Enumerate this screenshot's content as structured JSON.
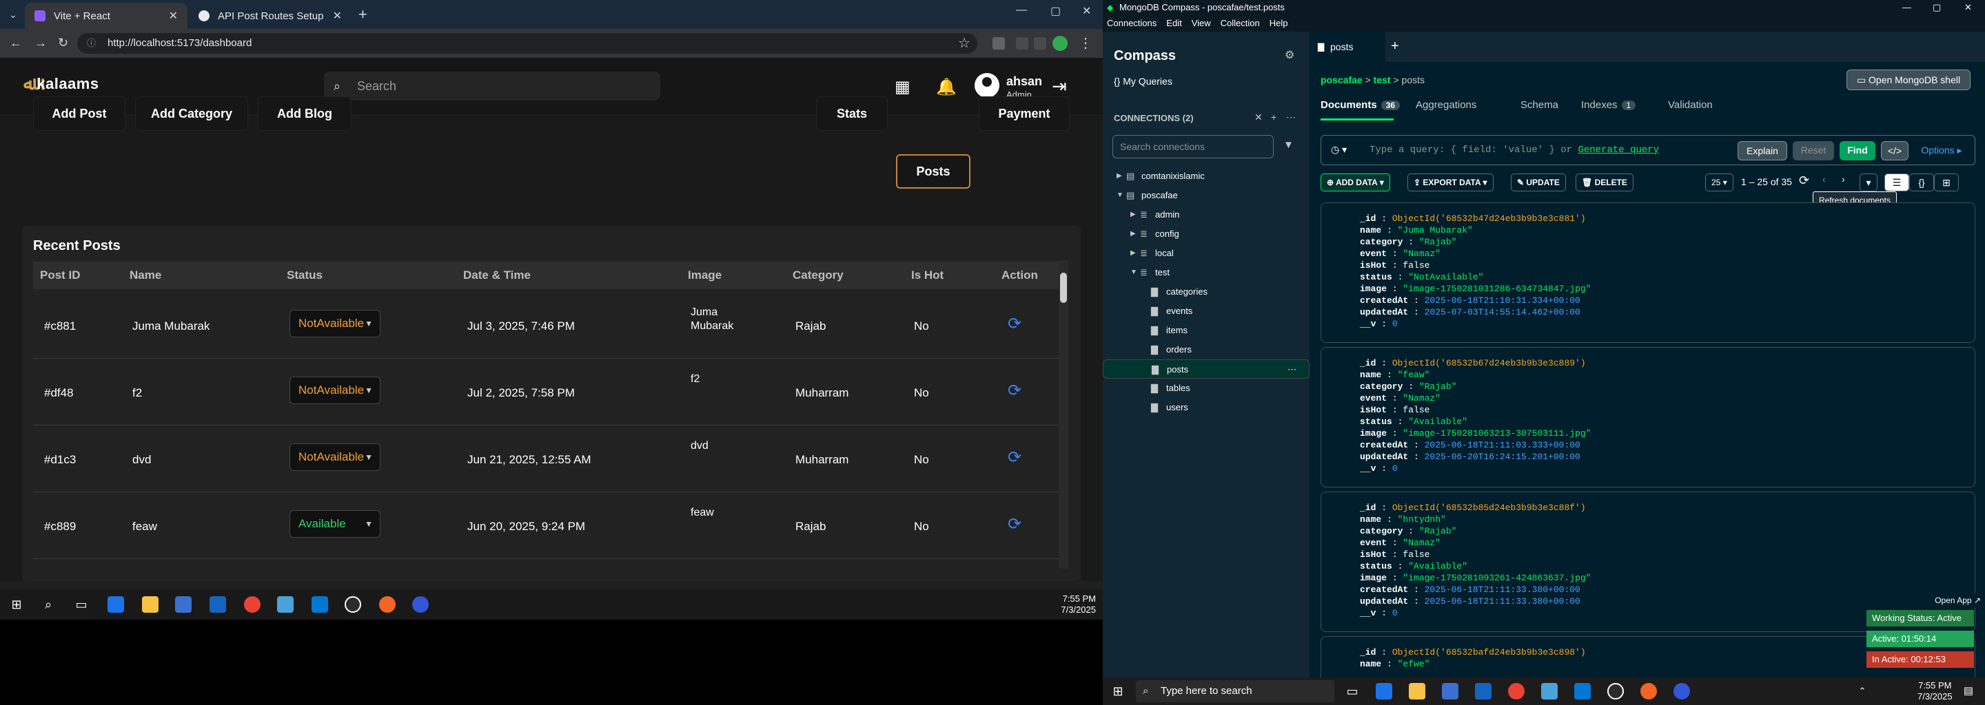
{
  "browser": {
    "tabs": [
      {
        "title": "Vite + React",
        "active": true
      },
      {
        "title": "API Post Routes Setup",
        "active": false
      }
    ],
    "url": "http://localhost:5173/dashboard"
  },
  "app": {
    "logo": "kalaams",
    "search_placeholder": "Search",
    "user": {
      "name": "ahsan",
      "role": "Admin"
    },
    "left_buttons": [
      "Add Post",
      "Add Category",
      "Add Blog"
    ],
    "right_buttons": [
      "Stats",
      "Posts",
      "Payment"
    ],
    "active_tab": "Posts",
    "panel_title": "Recent Posts",
    "columns": [
      "Post ID",
      "Name",
      "Status",
      "Date & Time",
      "Image",
      "Category",
      "Is Hot",
      "Action"
    ],
    "rows": [
      {
        "id": "#c881",
        "name": "Juma Mubarak",
        "status": "NotAvailable",
        "date": "Jul 3, 2025, 7:46 PM",
        "image_alt": "Juma Mubarak",
        "category": "Rajab",
        "hot": "No"
      },
      {
        "id": "#df48",
        "name": "f2",
        "status": "NotAvailable",
        "date": "Jul 2, 2025, 7:58 PM",
        "image_alt": "f2",
        "category": "Muharram",
        "hot": "No"
      },
      {
        "id": "#d1c3",
        "name": "dvd",
        "status": "NotAvailable",
        "date": "Jun 21, 2025, 12:55 AM",
        "image_alt": "dvd",
        "category": "Muharram",
        "hot": "No"
      },
      {
        "id": "#c889",
        "name": "feaw",
        "status": "Available",
        "date": "Jun 20, 2025, 9:24 PM",
        "image_alt": "feaw",
        "category": "Rajab",
        "hot": "No"
      }
    ]
  },
  "left_taskbar": {
    "time": "7:55 PM",
    "date": "7/3/2025"
  },
  "compass": {
    "title": "MongoDB Compass - poscafae/test.posts",
    "menu": [
      "Connections",
      "Edit",
      "View",
      "Collection",
      "Help"
    ],
    "sidebar_title": "Compass",
    "my_queries": "My Queries",
    "connections_label": "CONNECTIONS (2)",
    "search_placeholder": "Search connections",
    "tree": [
      {
        "label": "comtanixislamic",
        "level": 0,
        "type": "conn",
        "expanded": false
      },
      {
        "label": "poscafae",
        "level": 0,
        "type": "conn",
        "expanded": true
      },
      {
        "label": "admin",
        "level": 1,
        "type": "db",
        "expanded": false
      },
      {
        "label": "config",
        "level": 1,
        "type": "db",
        "expanded": false
      },
      {
        "label": "local",
        "level": 1,
        "type": "db",
        "expanded": false
      },
      {
        "label": "test",
        "level": 1,
        "type": "db",
        "expanded": true
      },
      {
        "label": "categories",
        "level": 2,
        "type": "coll"
      },
      {
        "label": "events",
        "level": 2,
        "type": "coll"
      },
      {
        "label": "items",
        "level": 2,
        "type": "coll"
      },
      {
        "label": "orders",
        "level": 2,
        "type": "coll"
      },
      {
        "label": "posts",
        "level": 2,
        "type": "coll",
        "selected": true
      },
      {
        "label": "tables",
        "level": 2,
        "type": "coll"
      },
      {
        "label": "users",
        "level": 2,
        "type": "coll"
      }
    ],
    "tab_title": "posts",
    "breadcrumb": {
      "cluster": "poscafae",
      "db": "test",
      "coll": "posts"
    },
    "open_shell": "Open MongoDB shell",
    "subtabs": [
      {
        "label": "Documents",
        "badge": "36"
      },
      {
        "label": "Aggregations",
        "badge": ""
      },
      {
        "label": "Schema",
        "badge": ""
      },
      {
        "label": "Indexes",
        "badge": "1"
      },
      {
        "label": "Validation",
        "badge": ""
      }
    ],
    "query_placeholder": "Type a query: { field: 'value' } or",
    "generate_query": "Generate query",
    "explain": "Explain",
    "reset": "Reset",
    "find": "Find",
    "options": "Options",
    "toolbar": {
      "add": "ADD DATA",
      "export": "EXPORT DATA",
      "update": "UPDATE",
      "delete": "DELETE"
    },
    "page_size": "25",
    "range": "1 – 25 of 35",
    "tooltip": "Refresh documents",
    "docs": [
      {
        "_id": "ObjectId('68532b47d24eb3b9b3e3c881')",
        "name": "\"Juma Mubarak\"",
        "category": "\"Rajab\"",
        "event": "\"Namaz\"",
        "isHot": "false",
        "status": "\"NotAvailable\"",
        "image": "\"image-1750281031286-634734847.jpg\"",
        "createdAt": "2025-06-18T21:10:31.334+00:00",
        "updatedAt": "2025-07-03T14:55:14.462+00:00",
        "__v": "0"
      },
      {
        "_id": "ObjectId('68532b67d24eb3b9b3e3c889')",
        "name": "\"feaw\"",
        "category": "\"Rajab\"",
        "event": "\"Namaz\"",
        "isHot": "false",
        "status": "\"Available\"",
        "image": "\"image-1750281063213-307503111.jpg\"",
        "createdAt": "2025-06-18T21:11:03.333+00:00",
        "updatedAt": "2025-06-20T16:24:15.201+00:00",
        "__v": "0"
      },
      {
        "_id": "ObjectId('68532b85d24eb3b9b3e3c88f')",
        "name": "\"hntydnh\"",
        "category": "\"Rajab\"",
        "event": "\"Namaz\"",
        "isHot": "false",
        "status": "\"Available\"",
        "image": "\"image-1750281093261-424863637.jpg\"",
        "createdAt": "2025-06-18T21:11:33.380+00:00",
        "updatedAt": "2025-06-18T21:11:33.380+00:00",
        "__v": "0"
      },
      {
        "_id": "ObjectId('68532bafd24eb3b9b3e3c898')",
        "name": "\"efwe\""
      }
    ],
    "open_app": "Open App",
    "status_widgets": [
      {
        "text": "Working Status: Active",
        "color": "#1e7a3e"
      },
      {
        "text": "Active: 01:50:14",
        "color": "#22a55a"
      },
      {
        "text": "In Active: 00:12:53",
        "color": "#c0392b"
      }
    ],
    "search_taskbar": "Type here to search",
    "time": "7:55 PM",
    "date": "7/3/2025"
  }
}
